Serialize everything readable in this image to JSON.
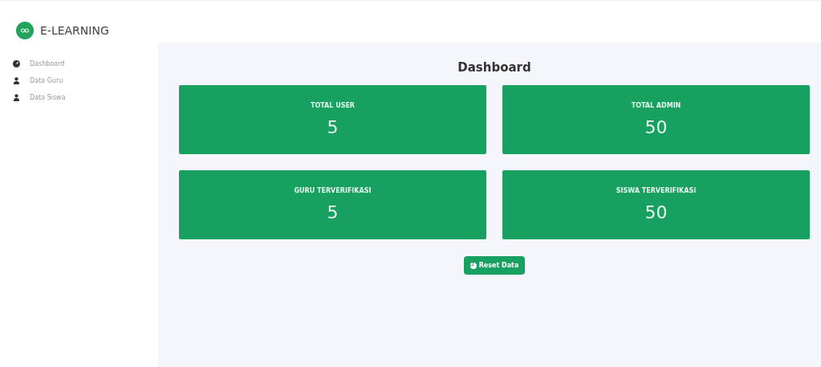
{
  "brand": {
    "name": "E-LEARNING"
  },
  "sidebar": {
    "items": [
      {
        "label": "Dashboard",
        "kind": "dashboard"
      },
      {
        "label": "Data Guru",
        "kind": "user"
      },
      {
        "label": "Data Siswa",
        "kind": "user"
      }
    ]
  },
  "main": {
    "title": "Dashboard",
    "cards": [
      {
        "label": "TOTAL USER",
        "value": "5"
      },
      {
        "label": "TOTAL ADMIN",
        "value": "50"
      },
      {
        "label": "GURU TERVERIFIKASI",
        "value": "5"
      },
      {
        "label": "SISWA TERVERIFIKASI",
        "value": "50"
      }
    ],
    "button": "Reset Data"
  }
}
